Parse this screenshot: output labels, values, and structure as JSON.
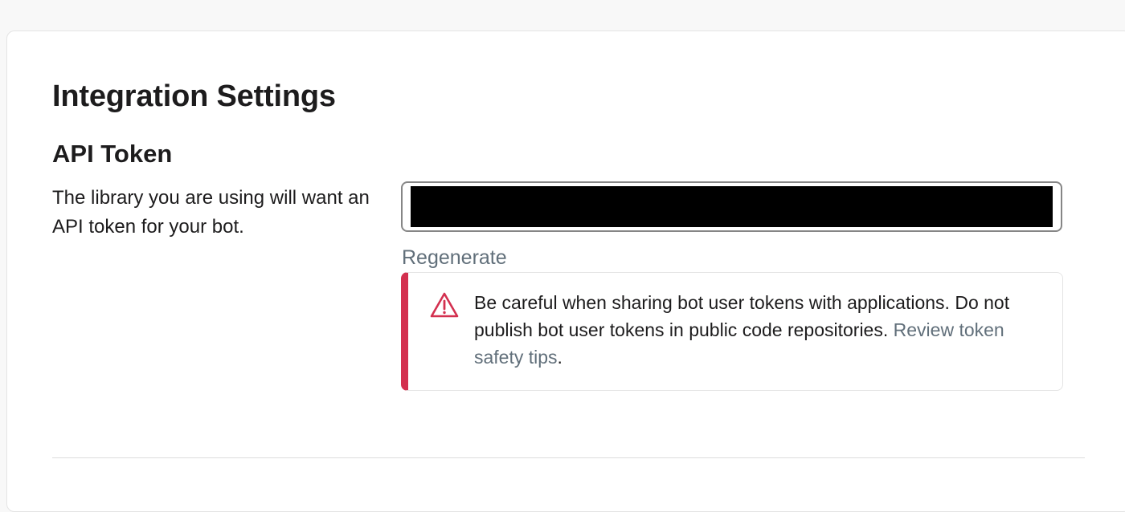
{
  "page": {
    "title": "Integration Settings"
  },
  "api_token": {
    "heading": "API Token",
    "description": "The library you are using will want an API token for your bot.",
    "regenerate_label": "Regenerate"
  },
  "warning": {
    "text_before_link": "Be careful when sharing bot user tokens with applications. Do not publish bot user tokens in public code repositories. ",
    "link_text": "Review token safety tips",
    "text_after_link": ".",
    "icon": "warning-triangle-icon",
    "accent_color": "#d3304f"
  },
  "colors": {
    "link": "#616f7a",
    "text": "#1d1c1d"
  }
}
